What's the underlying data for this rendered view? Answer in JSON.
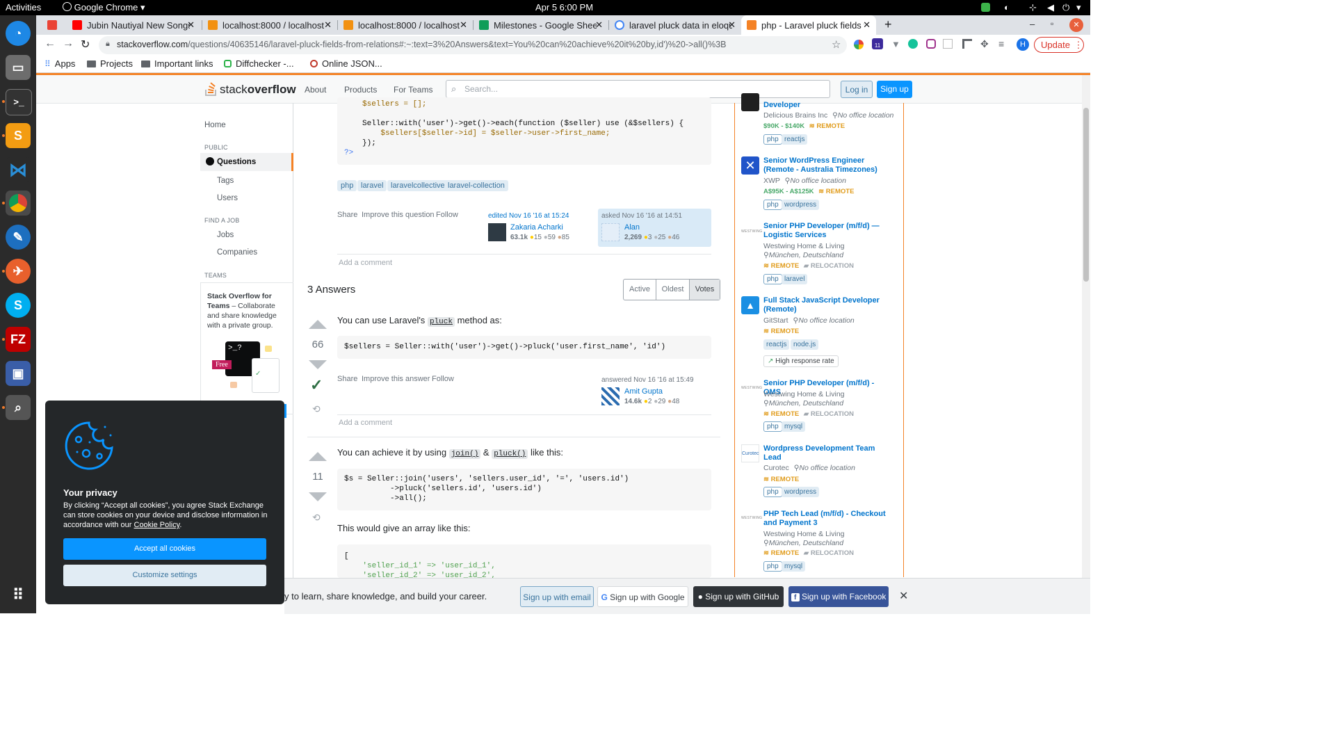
{
  "os": {
    "activities": "Activities",
    "app_name": "Google Chrome",
    "clock": "Apr 5  6:00 PM"
  },
  "tabs": [
    {
      "title": "Jubin Nautiyal New Songs"
    },
    {
      "title": "localhost:8000 / localhost"
    },
    {
      "title": "localhost:8000 / localhost"
    },
    {
      "title": "Milestones - Google Sheets"
    },
    {
      "title": "laravel pluck data in eloquent"
    },
    {
      "title": "php - Laravel pluck fields from"
    }
  ],
  "address": {
    "domain": "stackoverflow.com",
    "path": "/questions/40635146/laravel-pluck-fields-from-relations#:~:text=3%20Answers&text=You%20can%20achieve%20it%20by,id')%20->all()%3B"
  },
  "update_label": "Update",
  "profile_initial": "H",
  "bookmarks": [
    "Apps",
    "Projects",
    "Important links",
    "Diffchecker -...",
    "Online JSON..."
  ],
  "so": {
    "logo_a": "stack",
    "logo_b": "overflow",
    "nav": [
      "About",
      "Products",
      "For Teams"
    ],
    "search_placeholder": "Search...",
    "login": "Log in",
    "signup": "Sign up"
  },
  "leftnav": {
    "home": "Home",
    "public": "PUBLIC",
    "questions": "Questions",
    "tags": "Tags",
    "users": "Users",
    "find_job": "FIND A JOB",
    "jobs": "Jobs",
    "companies": "Companies",
    "teams": "TEAMS",
    "teams_title": "Stack Overflow for Teams",
    "teams_desc": " – Collaborate and share knowledge with a private group.",
    "free": "Free"
  },
  "question": {
    "code_lines": [
      "$sellers = [];",
      "",
      "Seller::with('user')->get()->each(function ($seller) use (&$sellers) {",
      "    $sellers[$seller->id] = $seller->user->first_name;",
      "});",
      "?>"
    ],
    "tags": [
      "php",
      "laravel",
      "laravelcollective",
      "laravel-collection"
    ],
    "share": "Share",
    "improve": "Improve this question",
    "follow": "Follow",
    "edited": "edited Nov 16 '16 at 15:24",
    "editor": "Zakaria Acharki",
    "editor_rep": "63.1k",
    "editor_badges": [
      "15",
      "59",
      "85"
    ],
    "asked": "asked Nov 16 '16 at 14:51",
    "asker": "Alan",
    "asker_rep": "2,269",
    "asker_badges": [
      "3",
      "25",
      "46"
    ],
    "add_comment": "Add a comment"
  },
  "answers_header": {
    "count": "3 Answers",
    "sorts": [
      "Active",
      "Oldest",
      "Votes"
    ]
  },
  "answer1": {
    "votes": "66",
    "text_a": "You can use Laravel's ",
    "code_inline": "pluck",
    "text_b": " method as:",
    "code": "$sellers = Seller::with('user')->get()->pluck('user.first_name', 'id')",
    "share": "Share",
    "improve": "Improve this answer",
    "follow": "Follow",
    "answered": "answered Nov 16 '16 at 15:49",
    "user": "Amit Gupta",
    "rep": "14.6k",
    "badges": [
      "2",
      "29",
      "48"
    ],
    "add_comment": "Add a comment"
  },
  "answer2": {
    "votes": "11",
    "text_a": "You can achieve it by using ",
    "code1": "join()",
    "amp": " & ",
    "code2": "pluck()",
    "text_b": " like this:",
    "code_lines": [
      "$s = Seller::join('users', 'sellers.user_id', '=', 'users.id')",
      "          ->pluck('sellers.id', 'users.id')",
      "          ->all();"
    ],
    "text2": "This would give an array like this:",
    "code2_lines": [
      "[",
      "    'seller_id_1' => 'user_id_1',",
      "    'seller_id_2' => 'user_id_2',"
    ]
  },
  "jobs": [
    {
      "title": "Developer",
      "company": "Delicious Brains Inc",
      "location": "No office location",
      "salary": "$90K - $140K",
      "remote": "REMOTE",
      "tags": [
        "php",
        "reactjs"
      ]
    },
    {
      "title": "Senior WordPress Engineer (Remote - Australia Timezones)",
      "company": "XWP",
      "location": "No office location",
      "salary": "A$95K - A$125K",
      "remote": "REMOTE",
      "tags": [
        "php",
        "wordpress"
      ]
    },
    {
      "title": "Senior PHP Developer (m/f/d) — Logistic Services",
      "company": "Westwing Home & Living",
      "location": "München, Deutschland",
      "remote": "REMOTE",
      "relocation": "RELOCATION",
      "tags": [
        "php",
        "laravel"
      ],
      "logo_text": "WESTWING"
    },
    {
      "title": "Full Stack JavaScript Developer (Remote)",
      "company": "GitStart",
      "location": "No office location",
      "remote": "REMOTE",
      "tags": [
        "reactjs",
        "node.js"
      ],
      "extra": "High response rate"
    },
    {
      "title": "Senior PHP Developer (m/f/d) - OMS",
      "company": "Westwing Home & Living",
      "location": "München, Deutschland",
      "remote": "REMOTE",
      "relocation": "RELOCATION",
      "tags": [
        "php",
        "mysql"
      ],
      "logo_text": "WESTWING"
    },
    {
      "title": "Wordpress Development Team Lead",
      "company": "Curotec",
      "location": "No office location",
      "remote": "REMOTE",
      "tags": [
        "php",
        "wordpress"
      ],
      "logo_text": "Curotec"
    },
    {
      "title": "PHP Tech Lead (m/f/d) - Checkout and Payment 3",
      "company": "Westwing Home & Living",
      "location": "München, Deutschland",
      "remote": "REMOTE",
      "relocation": "RELOCATION",
      "tags": [
        "php",
        "mysql"
      ],
      "logo_text": "WESTWING"
    }
  ],
  "cookie": {
    "title": "Your privacy",
    "text": "By clicking “Accept all cookies”, you agree Stack Exchange can store cookies on your device and disclose information in accordance with our ",
    "policy": "Cookie Policy",
    "period": ".",
    "accept": "Accept all cookies",
    "customize": "Customize settings"
  },
  "banner": {
    "text": "y to learn, share knowledge, and build your career.",
    "email": "Sign up with email",
    "google": "Sign up with Google",
    "github": "Sign up with GitHub",
    "facebook": "Sign up with Facebook"
  },
  "colors": {
    "so_orange": "#f48225",
    "so_blue": "#0a95ff",
    "accepted_green": "#2f6f44"
  }
}
